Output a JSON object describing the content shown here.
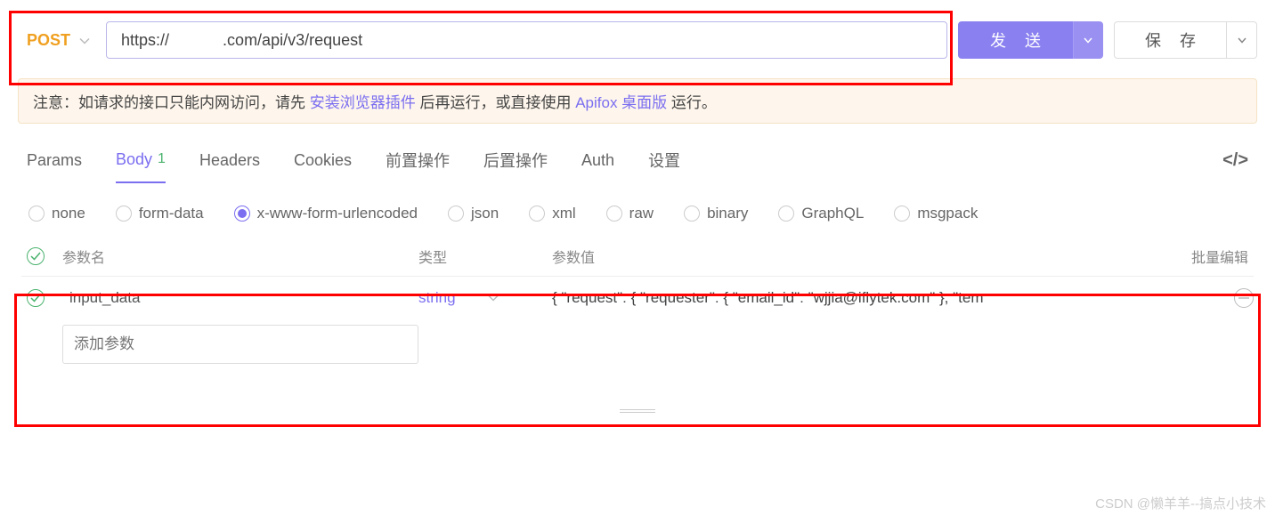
{
  "request": {
    "method": "POST",
    "url": "https://            .com/api/v3/request"
  },
  "buttons": {
    "send": "发 送",
    "save": "保 存"
  },
  "notice": {
    "prefix": "注意：如请求的接口只能内网访问，请先 ",
    "link1": "安装浏览器插件",
    "mid": " 后再运行，或直接使用 ",
    "link2": "Apifox 桌面版",
    "suffix": " 运行。"
  },
  "tabs": {
    "params": "Params",
    "body": "Body",
    "body_badge": "1",
    "headers": "Headers",
    "cookies": "Cookies",
    "pre": "前置操作",
    "post": "后置操作",
    "auth": "Auth",
    "settings": "设置"
  },
  "body_types": {
    "none": "none",
    "formdata": "form-data",
    "urlencoded": "x-www-form-urlencoded",
    "json": "json",
    "xml": "xml",
    "raw": "raw",
    "binary": "binary",
    "graphql": "GraphQL",
    "msgpack": "msgpack"
  },
  "table": {
    "col_name": "参数名",
    "col_type": "类型",
    "col_value": "参数值",
    "bulk_edit": "批量编辑",
    "rows": [
      {
        "name": "input_data",
        "type": "string",
        "value": "{    \"request\": {        \"requester\": {            \"email_id\": \"wjjia@iflytek.com\"        },        \"tem"
      }
    ],
    "add_placeholder": "添加参数"
  },
  "watermark": "CSDN @懒羊羊--搞点小技术"
}
